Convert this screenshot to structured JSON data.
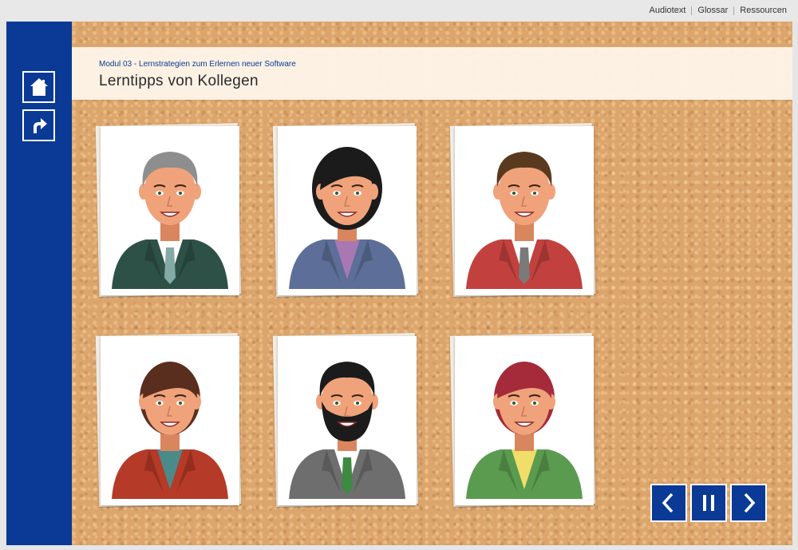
{
  "top_links": [
    "Audiotext",
    "Glossar",
    "Ressourcen"
  ],
  "header": {
    "module": "Modul 03 - Lernstrategien zum Erlernen neuer Software",
    "title": "Lerntipps von Kollegen"
  },
  "sidebar": {
    "icons": [
      "home-icon",
      "back-arrow-icon"
    ]
  },
  "colleagues": [
    {
      "hair": "#8e8e8e",
      "suit": "#2e5147",
      "shirt": "#ffffff",
      "tie": "#84aaa6",
      "style": "short"
    },
    {
      "hair": "#1b1b1b",
      "suit": "#5d6f98",
      "shirt": "#a778b1",
      "tie": "",
      "style": "bob"
    },
    {
      "hair": "#5a3a1f",
      "suit": "#c2413f",
      "shirt": "#ffffff",
      "tie": "#7a7a7a",
      "style": "short"
    },
    {
      "hair": "#5a2e1e",
      "suit": "#b53a28",
      "shirt": "#4b8a8a",
      "tie": "",
      "style": "female-short"
    },
    {
      "hair": "#1b1b1b",
      "suit": "#6e6e6e",
      "shirt": "#ffffff",
      "tie": "#3e8a42",
      "style": "beard"
    },
    {
      "hair": "#a52a3a",
      "suit": "#5b9b4f",
      "shirt": "#f1dd6a",
      "tie": "",
      "style": "female-short"
    }
  ],
  "nav_icons": [
    "prev-arrow-icon",
    "pause-icon",
    "next-arrow-icon"
  ],
  "colors": {
    "sidebar": "#0a3a96",
    "cork": "#dca56c",
    "accent": "#0a3a96"
  }
}
